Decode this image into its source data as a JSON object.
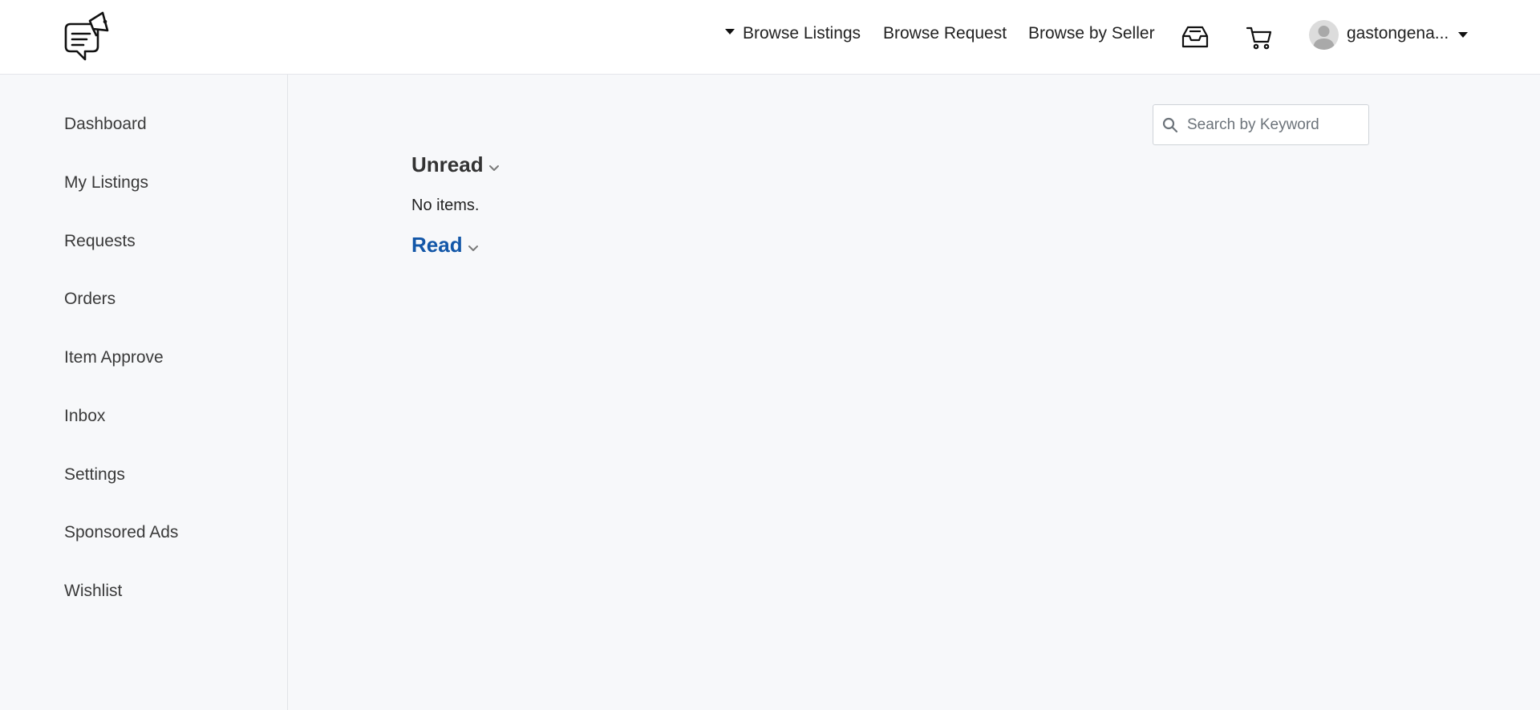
{
  "header": {
    "nav": {
      "browse_listings": "Browse Listings",
      "browse_request": "Browse Request",
      "browse_by_seller": "Browse by Seller"
    },
    "icons": {
      "logo": "chat-megaphone-logo",
      "inbox": "inbox-tray-icon",
      "cart": "shopping-cart-icon",
      "avatar": "user-avatar"
    },
    "user": {
      "name": "gastongena..."
    }
  },
  "sidebar": {
    "items": [
      {
        "label": "Dashboard"
      },
      {
        "label": "My Listings"
      },
      {
        "label": "Requests"
      },
      {
        "label": "Orders"
      },
      {
        "label": "Item Approve"
      },
      {
        "label": "Inbox"
      },
      {
        "label": "Settings"
      },
      {
        "label": "Sponsored Ads"
      },
      {
        "label": "Wishlist"
      }
    ]
  },
  "main": {
    "search": {
      "placeholder": "Search by Keyword",
      "value": ""
    },
    "sections": {
      "unread": {
        "title": "Unread",
        "empty_text": "No items."
      },
      "read": {
        "title": "Read"
      }
    }
  },
  "colors": {
    "page_background": "#f7f8fa",
    "header_background": "#ffffff",
    "read_link": "#1357a8",
    "text": "#222222"
  }
}
